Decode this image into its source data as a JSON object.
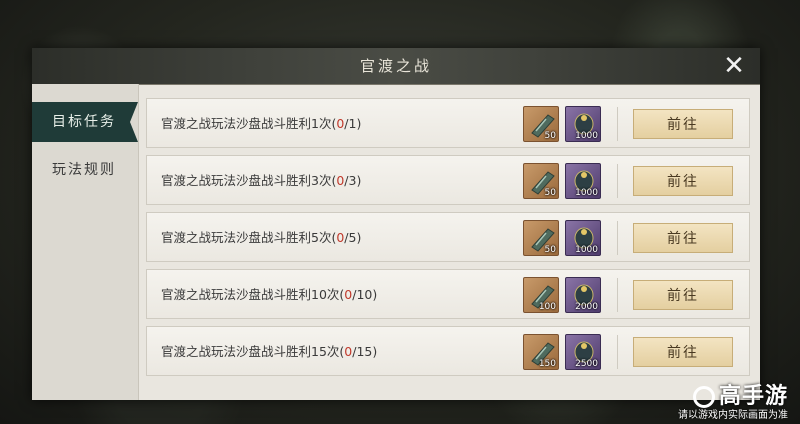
{
  "window": {
    "title": "官渡之战",
    "close_icon": "close-icon"
  },
  "sidebar": {
    "items": [
      {
        "label": "目标任务",
        "active": true
      },
      {
        "label": "玩法规则",
        "active": false
      }
    ]
  },
  "tasks": [
    {
      "text": "官渡之战玩法沙盘战斗胜利1次(",
      "current": "0",
      "total": "/1)",
      "reward1_qty": "50",
      "reward2_qty": "1000",
      "button": "前往"
    },
    {
      "text": "官渡之战玩法沙盘战斗胜利3次(",
      "current": "0",
      "total": "/3)",
      "reward1_qty": "50",
      "reward2_qty": "1000",
      "button": "前往"
    },
    {
      "text": "官渡之战玩法沙盘战斗胜利5次(",
      "current": "0",
      "total": "/5)",
      "reward1_qty": "50",
      "reward2_qty": "1000",
      "button": "前往"
    },
    {
      "text": "官渡之战玩法沙盘战斗胜利10次(",
      "current": "0",
      "total": "/10)",
      "reward1_qty": "100",
      "reward2_qty": "2000",
      "button": "前往"
    },
    {
      "text": "官渡之战玩法沙盘战斗胜利15次(",
      "current": "0",
      "total": "/15)",
      "reward1_qty": "150",
      "reward2_qty": "2500",
      "button": "前往"
    }
  ],
  "watermark": {
    "brand": "高手游",
    "sub": "请以游戏内实际画面为准"
  },
  "colors": {
    "accent_tab": "#1f3b38",
    "progress_red": "#c0392b",
    "button_bg": "#e4cfa0"
  }
}
